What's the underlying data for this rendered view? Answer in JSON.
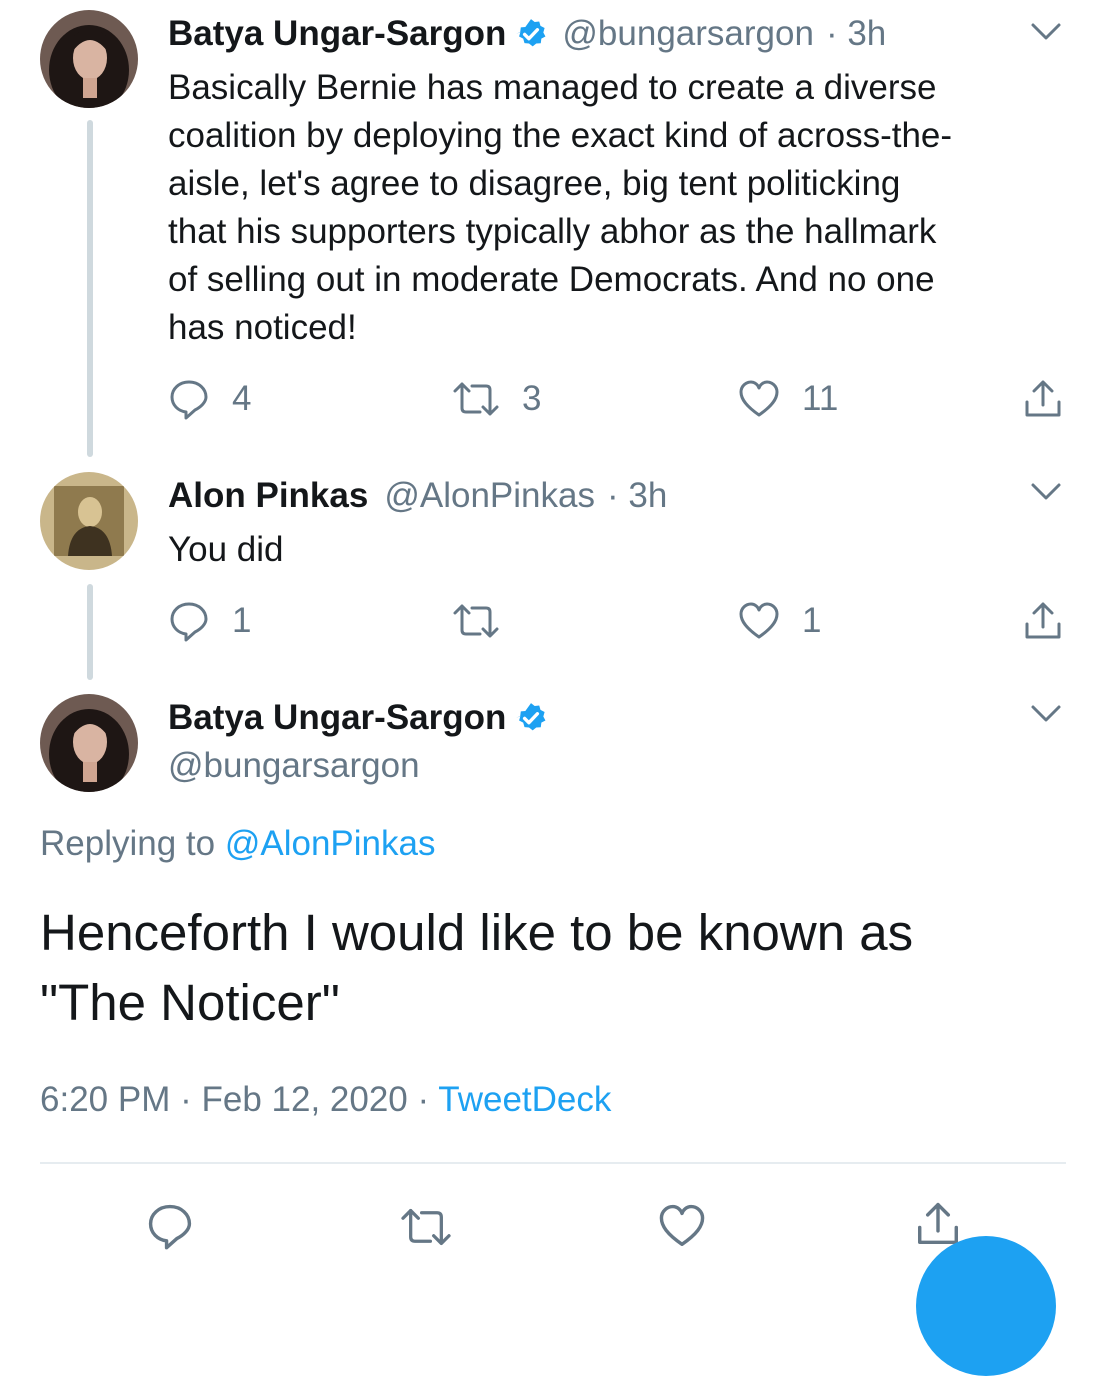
{
  "colors": {
    "accent": "#1da1f2",
    "secondary": "#657786",
    "divider": "#e6ecf0",
    "thread_line": "#cfd9de"
  },
  "tweets": [
    {
      "name": "Batya Ungar-Sargon",
      "handle": "@bungarsargon",
      "time": "· 3h",
      "text": "Basically Bernie has managed to create a diverse coalition by deploying the exact kind of across-the-aisle, let's agree to disagree, big tent politicking that his supporters typically abhor as the hallmark of selling out in moderate Democrats. And no one has noticed!",
      "text_lines": [
        "Basically Bernie has managed to create a diverse",
        "coalition by deploying the exact kind of across-the-",
        "aisle, let's agree to disagree, big tent politicking",
        "that his supporters typically abhor as the hallmark",
        "of selling out in moderate Democrats. And no one",
        "has noticed!"
      ],
      "replies": "4",
      "retweets": "3",
      "likes": "11",
      "icons": [
        "verified-badge-icon",
        "chevron-down-icon",
        "reply-icon",
        "retweet-icon",
        "heart-icon",
        "share-icon"
      ]
    },
    {
      "name": "Alon Pinkas",
      "handle": "@AlonPinkas",
      "time": "· 3h",
      "text": "You did",
      "replies": "1",
      "retweets": "",
      "likes": "1",
      "icons": [
        "chevron-down-icon",
        "reply-icon",
        "retweet-icon",
        "heart-icon",
        "share-icon"
      ]
    }
  ],
  "focused_tweet": {
    "name": "Batya Ungar-Sargon",
    "handle": "@bungarsargon",
    "replying_prefix": "Replying to",
    "replying_to": "@AlonPinkas",
    "text_lines": [
      "Henceforth I would like to be known as",
      "\"The Noticer\""
    ],
    "time": "6:20 PM",
    "date": "Feb 12, 2020",
    "source": "TweetDeck",
    "separator": "·",
    "icons": [
      "verified-badge-icon",
      "chevron-down-icon",
      "reply-icon",
      "retweet-icon",
      "heart-icon",
      "share-icon",
      "compose-fab"
    ]
  }
}
